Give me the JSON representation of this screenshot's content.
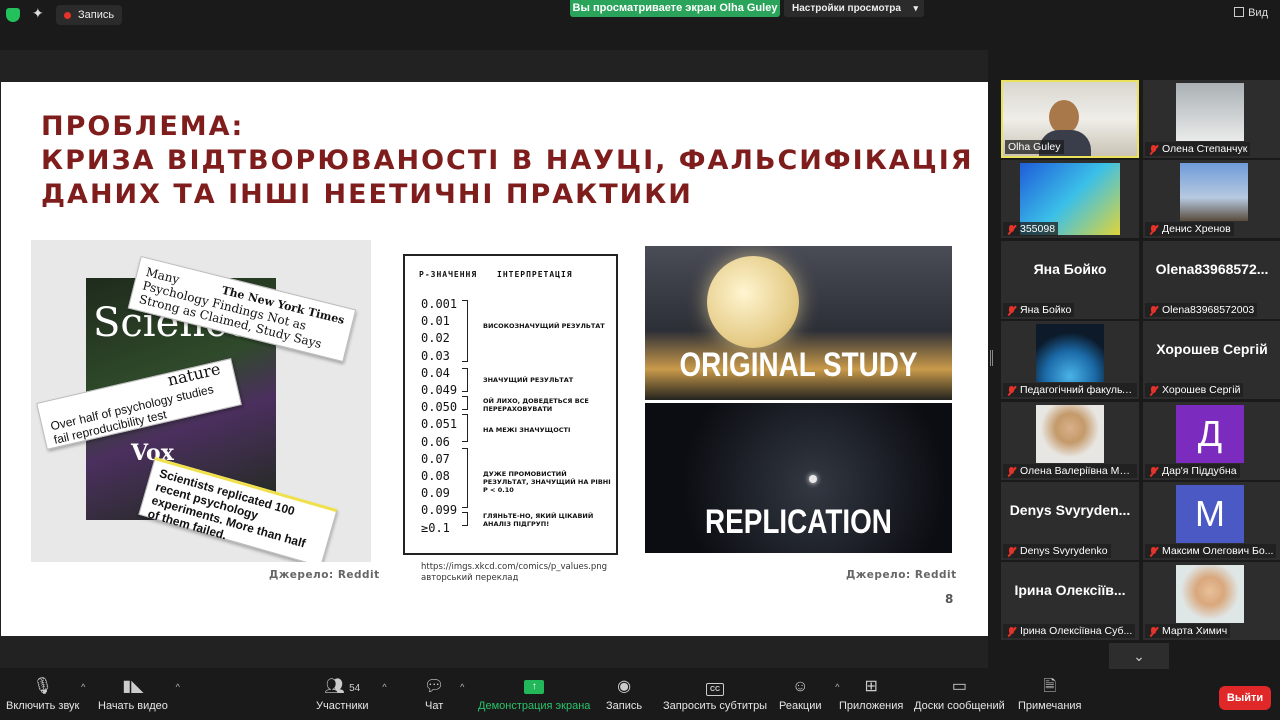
{
  "topbar": {
    "record_label": "Запись",
    "sharing_banner": "Вы просматриваете экран Olha Guley",
    "view_options_label": "Настройки просмотра",
    "view_label": "Вид"
  },
  "slide": {
    "title_lines": [
      "ПРОБЛЕМА:",
      "КРИЗА ВІДТВОРЮВАНОСТІ В НАУЦІ, ФАЛЬСИФІКАЦІЯ",
      "ДАНИХ ТА ІНШІ НЕЕТИЧНІ ПРАКТИКИ"
    ],
    "collage": {
      "science_word": "Science",
      "nyt_brand": "The New York Times",
      "nyt_headline": "Many Psychology Findings Not as Strong as Claimed, Study Says",
      "nature_brand": "nature",
      "nature_headline": "Over half of psychology studies fail reproducibility test",
      "vox_brand": "Vox",
      "vox_headline": "Scientists replicated 100 recent psychology experiments. More than half of them failed."
    },
    "comic": {
      "col_p": "P-ЗНАЧЕННЯ",
      "col_interp": "ІНТЕРПРЕТАЦІЯ",
      "pvalues": [
        "0.001",
        "0.01",
        "0.02",
        "0.03",
        "0.04",
        "0.049",
        "0.050",
        "0.051",
        "0.06",
        "0.07",
        "0.08",
        "0.09",
        "0.099",
        "≥0.1"
      ],
      "interpretations": [
        "ВИСОКОЗНАЧУЩИЙ РЕЗУЛЬТАТ",
        "ЗНАЧУЩИЙ РЕЗУЛЬТАТ",
        "ОЙ ЛИХО, ДОВЕДЕТЬСЯ ВСЕ ПЕРЕРАХОВУВАТИ",
        "НА МЕЖІ ЗНАЧУЩОСТІ",
        "ДУЖЕ ПРОМОВИСТИЙ РЕЗУЛЬТАТ, ЗНАЧУЩИЙ НА РІВНІ P < 0.10",
        "ГЛЯНЬТЕ-НО, ЯКИЙ ЦІКАВИЙ АНАЛІЗ ПІДГРУП!"
      ]
    },
    "moon_top_caption": "ORIGINAL STUDY",
    "moon_bottom_caption": "REPLICATION",
    "source_left": "Джерело: Reddit",
    "source_right": "Джерело: Reddit",
    "comic_url": "https://imgs.xkcd.com/comics/p_values.png",
    "comic_note": "авторський переклад",
    "page_number": "8"
  },
  "participants": [
    {
      "label": "Olha Guley",
      "display": "",
      "muted": false
    },
    {
      "label": "Олена Степанчук",
      "display": "",
      "muted": true
    },
    {
      "label": "355098",
      "display": "",
      "muted": true
    },
    {
      "label": "Денис Хренов",
      "display": "",
      "muted": true
    },
    {
      "label": "Яна Бойко",
      "display": "Яна Бойко",
      "muted": true
    },
    {
      "label": "Olena83968572003",
      "display": "Olena83968572...",
      "muted": true
    },
    {
      "label": "Педагогічний факульт...",
      "display": "",
      "muted": true
    },
    {
      "label": "Хорошев Сергій",
      "display": "Хорошев Сергій",
      "muted": true
    },
    {
      "label": "Олена Валеріївна Мат...",
      "display": "",
      "muted": true
    },
    {
      "label": "Дар'я Піддубна",
      "display": "Д",
      "muted": true
    },
    {
      "label": "Denys Svyrydenko",
      "display": "Denys Svyryden...",
      "muted": true
    },
    {
      "label": "Максим Олегович Бо...",
      "display": "M",
      "muted": true
    },
    {
      "label": "Ірина Олексіївна Суб...",
      "display": "Ірина Олексіїв...",
      "muted": true
    },
    {
      "label": "Марта Химич",
      "display": "",
      "muted": true
    }
  ],
  "avatar_colors": {
    "letter_d": "#7b2bbd",
    "letter_m": "#4b59c4"
  },
  "toolbar": {
    "audio": "Включить звук",
    "video": "Начать видео",
    "participants": "Участники",
    "participants_count": "54",
    "chat": "Чат",
    "share": "Демонстрация экрана",
    "record": "Запись",
    "captions": "Запросить субтитры",
    "captions_icon": "CC",
    "reactions": "Реакции",
    "apps": "Приложения",
    "whiteboards": "Доски сообщений",
    "notes": "Примечания",
    "leave": "Выйти"
  }
}
